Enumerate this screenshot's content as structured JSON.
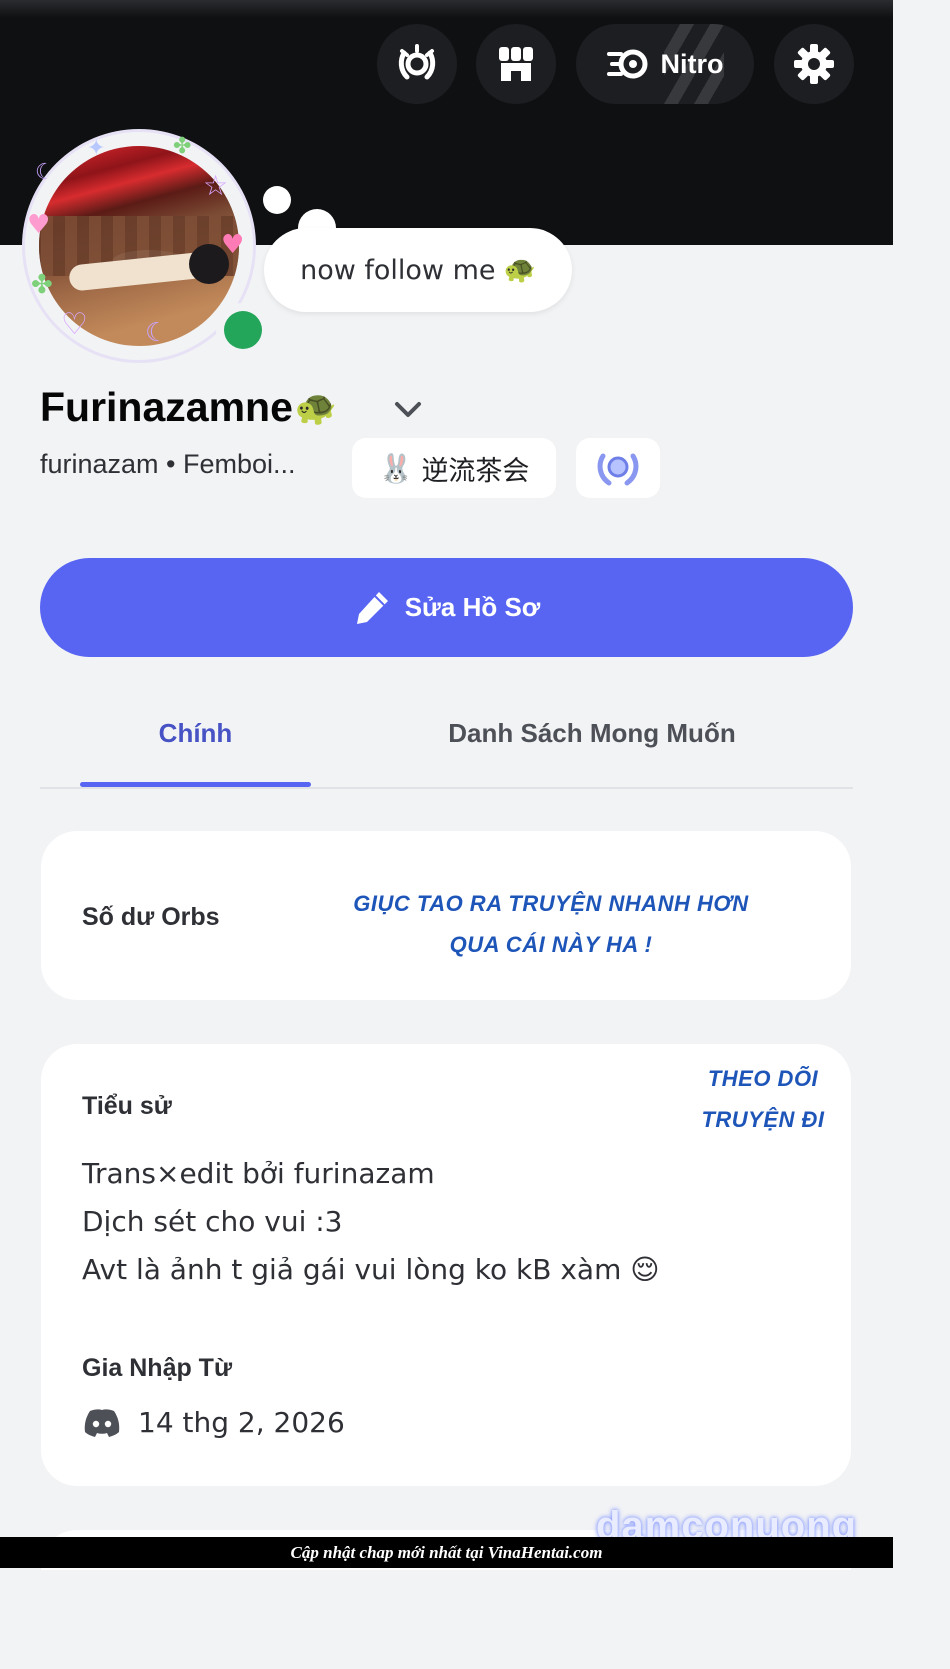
{
  "header": {
    "quests_icon": "quest-laurel-icon",
    "shop_icon": "shop-icon",
    "nitro_label": "Nitro",
    "settings_icon": "gear-icon"
  },
  "profile": {
    "status_message": "now follow me",
    "status_emoji": "🐢",
    "display_name": "Furinazamne",
    "display_name_emoji": "🐢",
    "username_line": "furinazam • Femboi...",
    "guild_tag_emoji": "🐰",
    "guild_tag": "逆流茶会",
    "online_color": "#23a55a"
  },
  "actions": {
    "edit_profile_label": "Sửa Hồ Sơ"
  },
  "tabs": [
    {
      "label": "Chính",
      "active": true
    },
    {
      "label": "Danh Sách Mong Muốn",
      "active": false
    }
  ],
  "orbs": {
    "label": "Số dư Orbs",
    "overlay_line1": "GIỤC TAO RA TRUYỆN NHANH HƠN",
    "overlay_line2": "QUA CÁI NÀY HA !"
  },
  "about": {
    "label": "Tiểu sử",
    "overlay_line1": "THEO DÕI",
    "overlay_line2": "TRUYỆN ĐI",
    "bio_line1": "Trans×edit bởi furinazam",
    "bio_line2": "Dịch sét cho vui :3",
    "bio_line3": "Avt là ảnh t giả gái vui lòng ko kB xàm",
    "bio_line3_emoji": "😌",
    "member_since_label": "Gia Nhập Từ",
    "member_since_date": "14 thg 2, 2026"
  },
  "watermark": "damconuong",
  "footer": "Cập nhật chap mới nhất tại VinaHentai.com",
  "colors": {
    "accent": "#5865f2",
    "accent_text": "#4752c4",
    "note_blue": "#1e55b8"
  }
}
